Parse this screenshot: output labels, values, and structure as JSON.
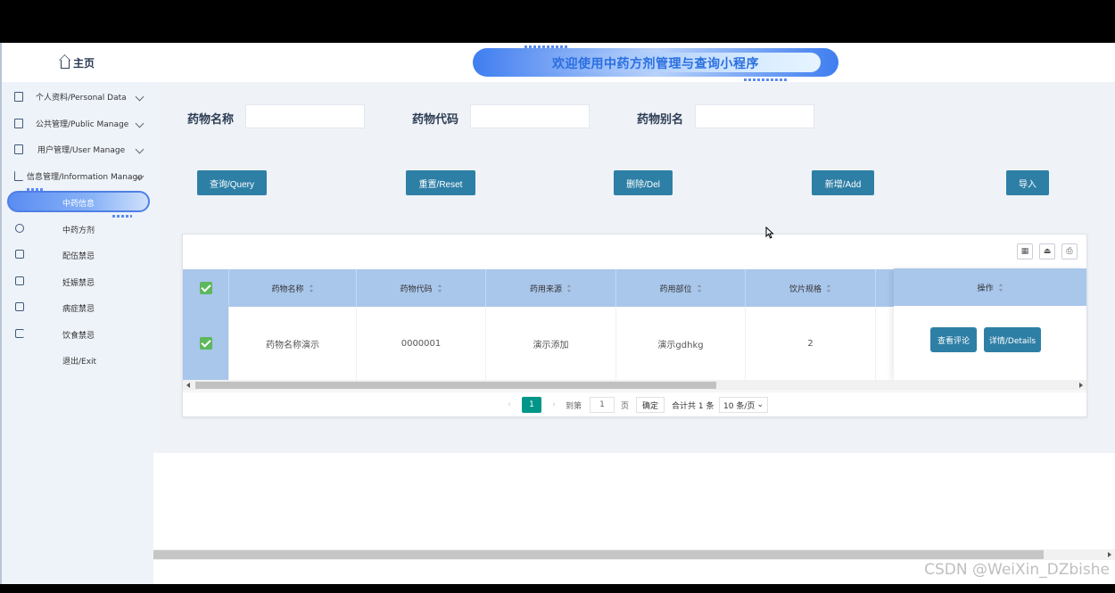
{
  "sidebar": {
    "home_label": "主页",
    "groups": [
      {
        "label": "个人资料/Personal Data"
      },
      {
        "label": "公共管理/Public Manage"
      },
      {
        "label": "用户管理/User Manage"
      },
      {
        "label": "信息管理/Information Manage"
      }
    ],
    "sub_items": [
      {
        "label": "中药信息",
        "active": true
      },
      {
        "label": "中药方剂"
      },
      {
        "label": "配伍禁忌"
      },
      {
        "label": "妊娠禁忌"
      },
      {
        "label": "病症禁忌"
      },
      {
        "label": "饮食禁忌"
      },
      {
        "label": "退出/Exit"
      }
    ]
  },
  "header": {
    "title": "欢迎使用中药方剂管理与查询小程序"
  },
  "search": {
    "fields": [
      {
        "label": "药物名称",
        "value": ""
      },
      {
        "label": "药物代码",
        "value": ""
      },
      {
        "label": "药物别名",
        "value": ""
      }
    ]
  },
  "actions": {
    "query": "查询/Query",
    "reset": "重置/Reset",
    "delete": "删除/Del",
    "add": "新增/Add",
    "import": "导入"
  },
  "table": {
    "columns": [
      "药物名称",
      "药物代码",
      "药用来源",
      "药用部位",
      "饮片规格"
    ],
    "ops_header": "操作",
    "rows": [
      {
        "name": "药物名称演示",
        "code": "0000001",
        "source": "演示添加",
        "part": "演示gdhkg",
        "spec": "2",
        "checked": true
      }
    ],
    "row_buttons": {
      "comments": "查看评论",
      "details": "详情/Details"
    }
  },
  "pagination": {
    "current_page": "1",
    "goto_label": "到第",
    "goto_value": "1",
    "page_unit": "页",
    "confirm": "确定",
    "total": "合计共 1 条",
    "page_size": "10 条/页"
  },
  "watermark": "CSDN @WeiXin_DZbishe",
  "colors": {
    "primary_button": "#2e7fa6",
    "table_header": "#a9c6eb",
    "active_page": "#009688",
    "checkbox": "#5cb85c"
  }
}
